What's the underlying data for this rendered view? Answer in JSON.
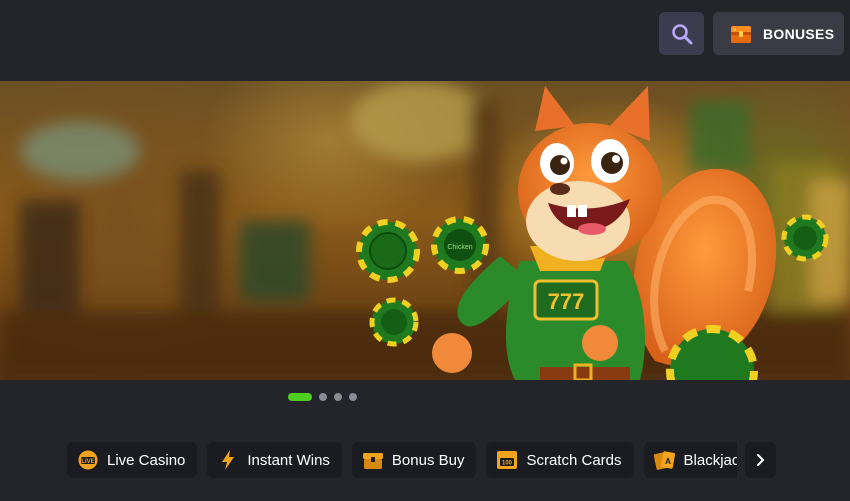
{
  "header": {
    "search_icon": "search-icon",
    "bonuses_label": "BONUSES",
    "bonuses_icon": "treasure-chest-icon"
  },
  "banner": {
    "chip_logo_text": "Chicken",
    "slot_text": "777",
    "slide_count": 4,
    "active_slide": 1
  },
  "categories": [
    {
      "label": "Live Casino",
      "icon": "live-casino-icon"
    },
    {
      "label": "Instant Wins",
      "icon": "lightning-icon"
    },
    {
      "label": "Bonus Buy",
      "icon": "bonus-buy-icon"
    },
    {
      "label": "Scratch Cards",
      "icon": "scratch-card-icon"
    },
    {
      "label": "Blackjack",
      "icon": "cards-icon"
    }
  ],
  "colors": {
    "accent": "#4ccf1f",
    "background": "#24252b",
    "chip_bg": "#1b1c21",
    "icon_gold": "#f2a41c"
  }
}
